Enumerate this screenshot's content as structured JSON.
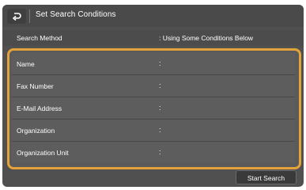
{
  "header": {
    "title": "Set Search Conditions",
    "back_icon": "back-arrow-icon"
  },
  "search_method": {
    "label": "Search Method",
    "value": ": Using Some Conditions Below"
  },
  "conditions": [
    {
      "label": "Name",
      "value": ":"
    },
    {
      "label": "Fax Number",
      "value": ":"
    },
    {
      "label": "E-Mail Address",
      "value": ":"
    },
    {
      "label": "Organization",
      "value": ":"
    },
    {
      "label": "Organization Unit",
      "value": ":"
    }
  ],
  "footer": {
    "start_search_label": "Start Search"
  },
  "colors": {
    "panel_background": "#505050",
    "highlight_border": "#e3a23a",
    "text": "#ffffff"
  }
}
